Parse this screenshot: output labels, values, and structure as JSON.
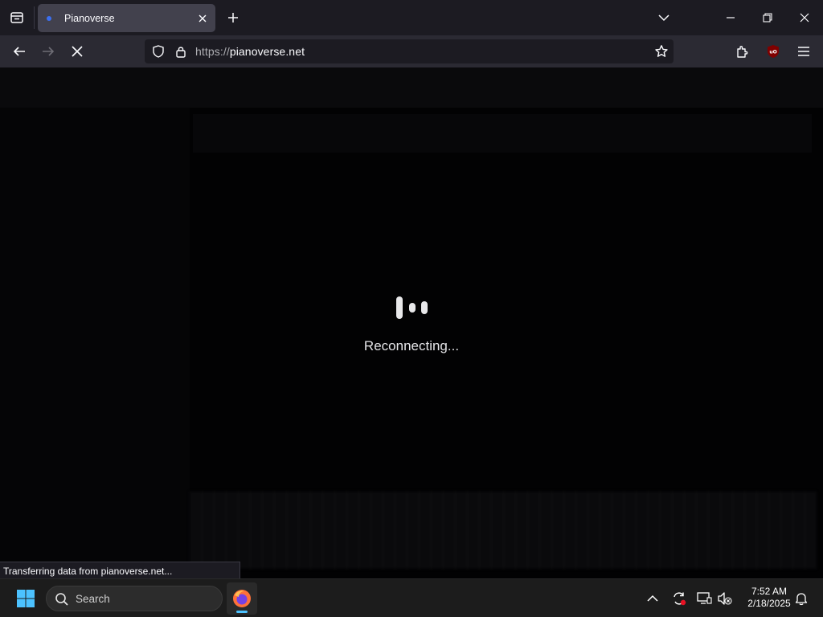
{
  "browser": {
    "tab_title": "Pianoverse",
    "url_scheme": "https://",
    "url_host": "pianoverse.net",
    "status_text": "Transferring data from pianoverse.net..."
  },
  "page": {
    "loading_message": "Reconnecting..."
  },
  "taskbar": {
    "search_label": "Search",
    "clock_time": "7:52 AM",
    "clock_date": "2/18/2025"
  },
  "colors": {
    "tab_active": "#42414d",
    "toolbar": "#2b2a33",
    "urlbar": "#1c1b22",
    "taskbar": "#1c1c1c",
    "accent_running": "#4cc2ff"
  }
}
